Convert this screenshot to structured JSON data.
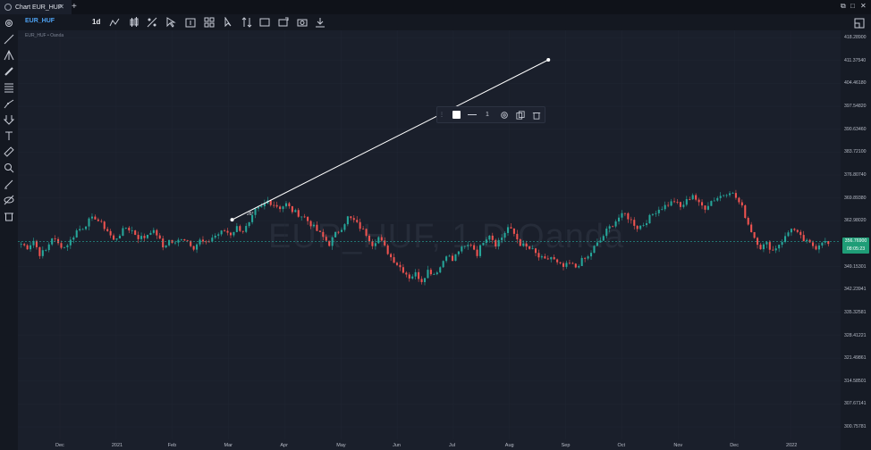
{
  "window": {
    "tab_title": "Chart EUR_HUF",
    "tab_close": "✕",
    "new_tab": "+",
    "controls": [
      "⧉",
      "□",
      "✕"
    ]
  },
  "toolbar": {
    "symbol": "EUR_HUF",
    "timeframe": "1d",
    "icons": [
      "indicator-icon",
      "candles-icon",
      "compare-icon",
      "cursor-icon",
      "import-icon",
      "templates-icon",
      "pointer-icon",
      "sort-icon",
      "rectangle-icon",
      "expand-icon",
      "screenshot-icon",
      "download-icon"
    ]
  },
  "sidebar": {
    "icons": [
      "settings-icon",
      "trendline-icon",
      "pitchfork-icon",
      "brush-icon",
      "fib-icon",
      "projection-icon",
      "arrow-down-icon",
      "text-icon",
      "ruler-icon",
      "zoom-icon",
      "pencil-icon",
      "eye-hide-icon",
      "trash-icon"
    ]
  },
  "chart": {
    "legend": "EUR_HUF • Oanda",
    "watermark": "EUR_HUF, 1 D Oanda",
    "drawing_angle": "26°",
    "floating_toolbar": {
      "line_width": "1",
      "color": "#ffffff"
    },
    "colors": {
      "up": "#26a69a",
      "down": "#ef5350",
      "background": "#1a1f2b",
      "price_line": "#26a69a"
    }
  },
  "chart_data": {
    "type": "candlestick",
    "y_ticks": [
      "418.28900",
      "411.37540",
      "404.46180",
      "397.54820",
      "390.63460",
      "383.72100",
      "376.80740",
      "369.89380",
      "362.98020",
      "356.06660",
      "349.15301",
      "342.23941",
      "335.32581",
      "328.41221",
      "321.49861",
      "314.58501",
      "307.67141",
      "300.75781"
    ],
    "x_ticks": [
      "Dec",
      "2021",
      "Feb",
      "Mar",
      "Apr",
      "May",
      "Jun",
      "Jul",
      "Aug",
      "Sep",
      "Oct",
      "Nov",
      "Dec",
      "2022"
    ],
    "ylim": [
      297.0,
      420.5
    ],
    "last_price": "356.76900",
    "countdown": "08:05:23",
    "trendline": {
      "start": {
        "period": "Mar",
        "price": 363.3
      },
      "end": {
        "period": "Aug-Sep",
        "price": 411.6
      }
    },
    "close_series": [
      356,
      355,
      357,
      353,
      354,
      358,
      356,
      355,
      357,
      360,
      361,
      363,
      364,
      362,
      360,
      357,
      359,
      361,
      360,
      358,
      358,
      360,
      359,
      355,
      357,
      356,
      358,
      357,
      355,
      357,
      356,
      358,
      359,
      360,
      359,
      361,
      360,
      362,
      366,
      367,
      369,
      368,
      367,
      368,
      366,
      365,
      364,
      362,
      360,
      358,
      356,
      359,
      361,
      364,
      363,
      361,
      359,
      356,
      358,
      355,
      352,
      350,
      348,
      346,
      347,
      345,
      348,
      347,
      349,
      353,
      351,
      354,
      355,
      356,
      353,
      357,
      359,
      356,
      358,
      361,
      359,
      356,
      355,
      354,
      352,
      351,
      352,
      350,
      349,
      350,
      349,
      351,
      352,
      355,
      357,
      360,
      362,
      364,
      365,
      363,
      361,
      362,
      364,
      366,
      367,
      368,
      369,
      367,
      369,
      371,
      368,
      367,
      369,
      370,
      371,
      372,
      370,
      367,
      362,
      358,
      355,
      356,
      354,
      356,
      358,
      361,
      359,
      357,
      356,
      355,
      357,
      356
    ]
  }
}
